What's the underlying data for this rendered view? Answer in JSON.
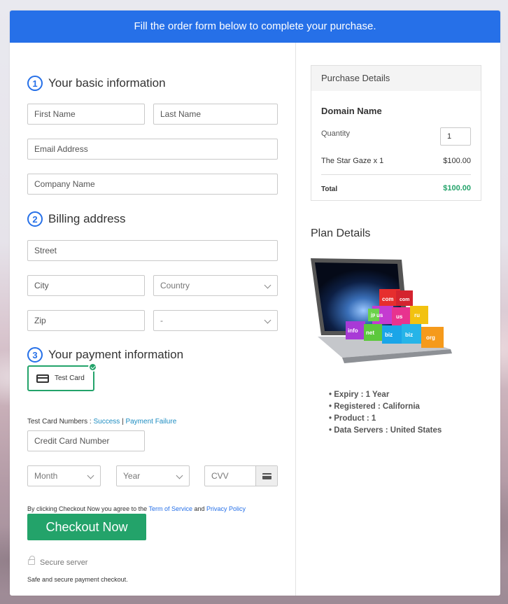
{
  "banner": "Fill the order form below to complete your purchase.",
  "basic": {
    "number": "1",
    "title": "Your basic information",
    "first_name": "First Name",
    "last_name": "Last Name",
    "email": "Email Address",
    "company": "Company Name"
  },
  "billing": {
    "number": "2",
    "title": "Billing address",
    "street": "Street",
    "city": "City",
    "country": "Country",
    "zip": "Zip",
    "state": "-"
  },
  "payment": {
    "number": "3",
    "title": "Your payment information",
    "test_card": "Test Card",
    "test_numbers_label": "Test Card Numbers :",
    "success": "Success",
    "separator": "|",
    "failure": "Payment Failure",
    "card_number": "Credit Card Number",
    "month": "Month",
    "year": "Year",
    "cvv": "CVV"
  },
  "terms": {
    "prefix": "By clicking Checkout Now you agree to the",
    "tos": "Term of Service",
    "and": "and",
    "privacy": "Privacy Policy"
  },
  "checkout_button": "Checkout Now",
  "secure_server": "Secure server",
  "safe_text": "Safe and secure payment checkout.",
  "purchase": {
    "title": "Purchase Details",
    "product": "Domain Name",
    "quantity_label": "Quantity",
    "quantity_value": "1",
    "item": "The Star Gaze x 1",
    "item_price": "$100.00",
    "total_label": "Total",
    "total_value": "$100.00"
  },
  "plan": {
    "title": "Plan Details",
    "cubes": [
      "com",
      "com",
      "us",
      "us",
      "ru",
      "info",
      "net",
      "biz",
      "biz",
      "org",
      "jp"
    ],
    "items": [
      "Expiry : 1 Year",
      "Registered : California",
      "Product : 1",
      "Data Servers : United States"
    ]
  },
  "colors": {
    "accent": "#2670e8",
    "success": "#23a36a",
    "link": "#1c8cc1"
  }
}
